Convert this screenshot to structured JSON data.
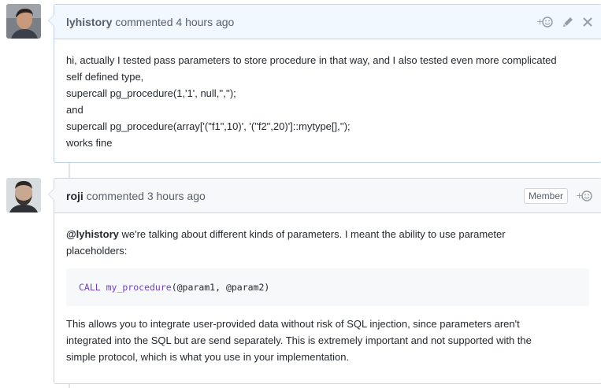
{
  "comments": [
    {
      "author": "lyhistory",
      "meta": "commented 4 hours ago",
      "lines": [
        "hi, actually I tested pass parameters to store procedure in that way, and I also tested even more complicated",
        "self defined type,",
        "supercall pg_procedure(1,'1', null,'','');",
        "and",
        "supercall pg_procedure(array['(\"f1\",10)', '(\"f2\",20)']::mytype[],'');",
        "works fine"
      ]
    },
    {
      "author": "roji",
      "meta": "commented 3 hours ago",
      "badge": "Member",
      "mention": "@lyhistory",
      "intro_rest": " we're talking about different kinds of parameters. I meant the ability to use parameter",
      "intro_line2": "placeholders:",
      "code_keyword": "CALL my_procedure",
      "code_rest": "(@param1, @param2)",
      "outro_lines": [
        "This allows you to integrate user-provided data without risk of SQL injection, since parameters aren't",
        "integrated into the SQL but are send separately. This is extremely important and not supported with the",
        "simple protocol, which is what you use in your implementation."
      ]
    }
  ],
  "icons": {
    "reaction": "add-reaction-icon",
    "edit": "pencil-icon",
    "delete": "close-icon"
  },
  "colors": {
    "owner_header_bg": "#f1f8ff",
    "owner_border": "#c0d3eb",
    "header_bg": "#f6f8fa",
    "border": "#d1d5da",
    "code_keyword": "#6f42c1"
  }
}
